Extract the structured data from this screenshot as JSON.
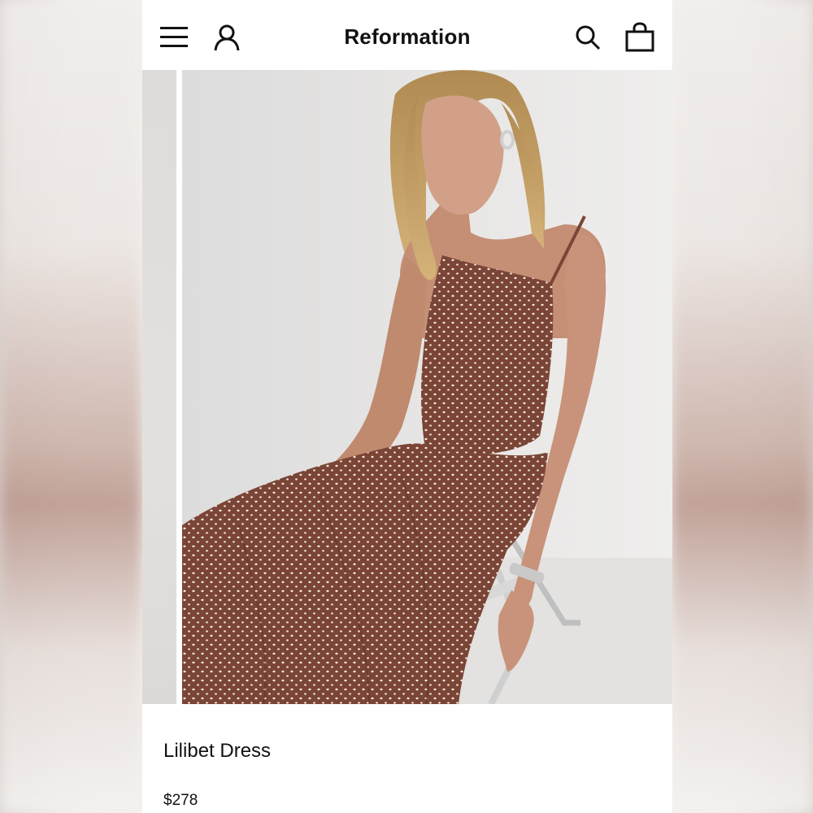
{
  "header": {
    "brand": "Reformation",
    "icons": [
      "menu-icon",
      "account-icon",
      "search-icon",
      "bag-icon"
    ]
  },
  "product": {
    "name": "Lilibet Dress",
    "price": "$278"
  },
  "colors": {
    "dress": "#7a4536",
    "dots": "#f2e6df",
    "background": "#ffffff",
    "text": "#111111"
  }
}
